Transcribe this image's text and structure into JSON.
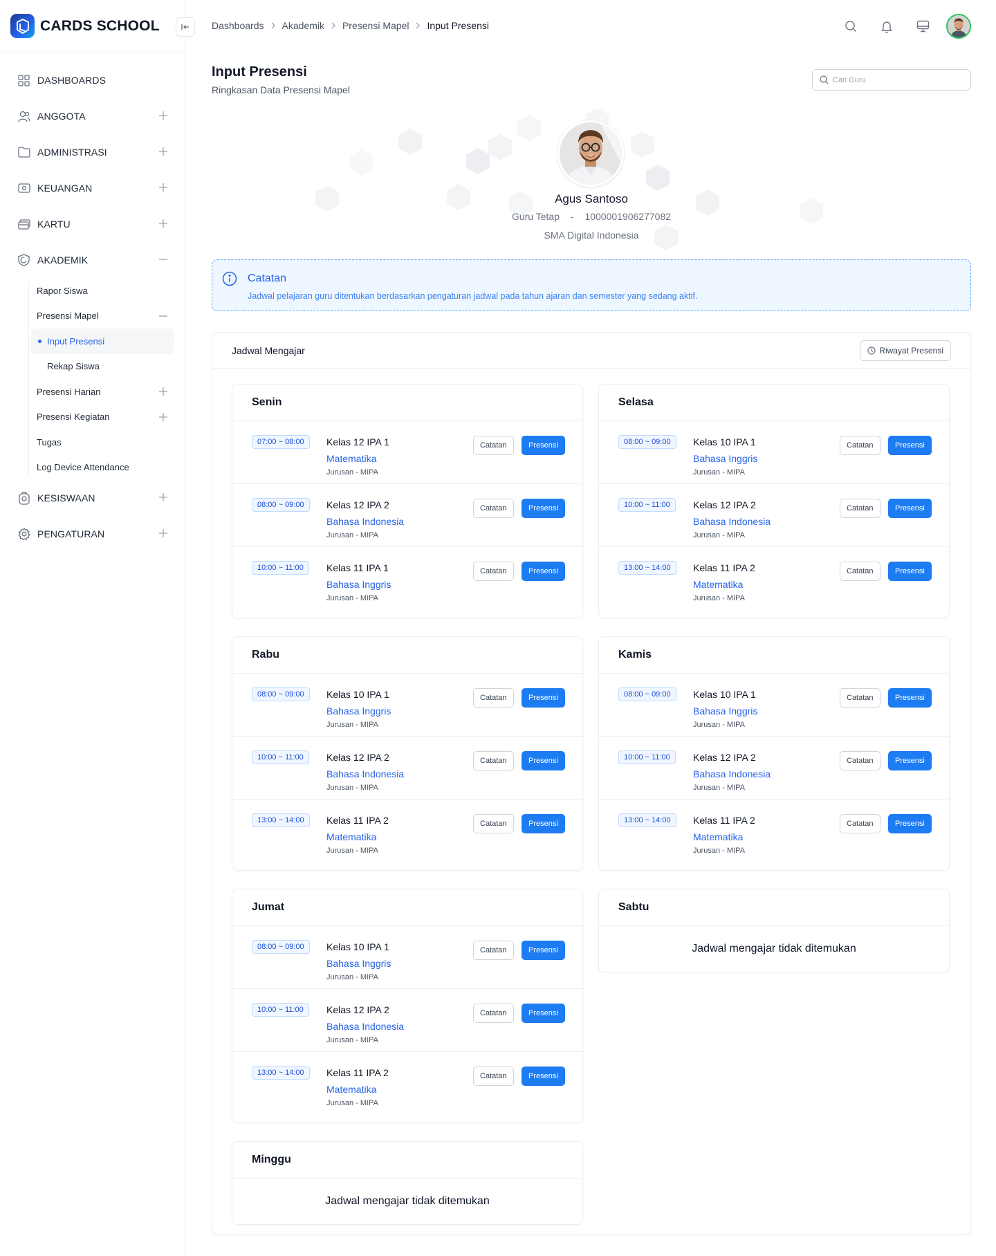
{
  "brand": {
    "name": "CARDS SCHOOL"
  },
  "sidebar": {
    "items": [
      {
        "label": "DASHBOARDS"
      },
      {
        "label": "ANGGOTA"
      },
      {
        "label": "ADMINISTRASI"
      },
      {
        "label": "KEUANGAN"
      },
      {
        "label": "KARTU"
      },
      {
        "label": "AKADEMIK"
      },
      {
        "label": "KESISWAAN"
      },
      {
        "label": "PENGATURAN"
      }
    ],
    "akademik": {
      "rapor": "Rapor Siswa",
      "presensi_mapel": "Presensi Mapel",
      "input_presensi": "Input Presensi",
      "rekap_siswa": "Rekap Siswa",
      "presensi_harian": "Presensi Harian",
      "presensi_kegiatan": "Presensi Kegiatan",
      "tugas": "Tugas",
      "log_device": "Log Device Attendance"
    }
  },
  "breadcrumb": [
    "Dashboards",
    "Akademik",
    "Presensi Mapel",
    "Input Presensi"
  ],
  "page": {
    "title": "Input Presensi",
    "subtitle": "Ringkasan Data Presensi Mapel",
    "search_placeholder": "Cari Guru"
  },
  "profile": {
    "name": "Agus Santoso",
    "status": "Guru Tetap",
    "dash": "-",
    "nip": "1000001906277082",
    "school": "SMA Digital Indonesia"
  },
  "note": {
    "title": "Catatan",
    "text": "Jadwal pelajaran guru ditentukan berdasarkan pengaturan jadwal pada tahun ajaran dan semester yang sedang aktif."
  },
  "schedule": {
    "title": "Jadwal Mengajar",
    "history_label": "Riwayat Presensi",
    "note_btn": "Catatan",
    "presensi_btn": "Presensi",
    "empty_text": "Jadwal mengajar tidak ditemukan",
    "days": [
      {
        "name": "Senin",
        "slots": [
          {
            "time": "07:00 ~ 08:00",
            "class": "Kelas 12 IPA 1",
            "subject": "Matematika",
            "major": "Jurusan - MIPA"
          },
          {
            "time": "08:00 ~ 09:00",
            "class": "Kelas 12 IPA 2",
            "subject": "Bahasa Indonesia",
            "major": "Jurusan - MIPA"
          },
          {
            "time": "10:00 ~ 11:00",
            "class": "Kelas 11 IPA 1",
            "subject": "Bahasa Inggris",
            "major": "Jurusan - MIPA"
          }
        ]
      },
      {
        "name": "Selasa",
        "slots": [
          {
            "time": "08:00 ~ 09:00",
            "class": "Kelas 10 IPA 1",
            "subject": "Bahasa Inggris",
            "major": "Jurusan - MIPA"
          },
          {
            "time": "10:00 ~ 11:00",
            "class": "Kelas 12 IPA 2",
            "subject": "Bahasa Indonesia",
            "major": "Jurusan - MIPA"
          },
          {
            "time": "13:00 ~ 14:00",
            "class": "Kelas 11 IPA 2",
            "subject": "Matematika",
            "major": "Jurusan - MIPA"
          }
        ]
      },
      {
        "name": "Rabu",
        "slots": [
          {
            "time": "08:00 ~ 09:00",
            "class": "Kelas 10 IPA 1",
            "subject": "Bahasa Inggris",
            "major": "Jurusan - MIPA"
          },
          {
            "time": "10:00 ~ 11:00",
            "class": "Kelas 12 IPA 2",
            "subject": "Bahasa Indonesia",
            "major": "Jurusan - MIPA"
          },
          {
            "time": "13:00 ~ 14:00",
            "class": "Kelas 11 IPA 2",
            "subject": "Matematika",
            "major": "Jurusan - MIPA"
          }
        ]
      },
      {
        "name": "Kamis",
        "slots": [
          {
            "time": "08:00 ~ 09:00",
            "class": "Kelas 10 IPA 1",
            "subject": "Bahasa Inggris",
            "major": "Jurusan - MIPA"
          },
          {
            "time": "10:00 ~ 11:00",
            "class": "Kelas 12 IPA 2",
            "subject": "Bahasa Indonesia",
            "major": "Jurusan - MIPA"
          },
          {
            "time": "13:00 ~ 14:00",
            "class": "Kelas 11 IPA 2",
            "subject": "Matematika",
            "major": "Jurusan - MIPA"
          }
        ]
      },
      {
        "name": "Jumat",
        "slots": [
          {
            "time": "08:00 ~ 09:00",
            "class": "Kelas 10 IPA 1",
            "subject": "Bahasa Inggris",
            "major": "Jurusan - MIPA"
          },
          {
            "time": "10:00 ~ 11:00",
            "class": "Kelas 12 IPA 2",
            "subject": "Bahasa Indonesia",
            "major": "Jurusan - MIPA"
          },
          {
            "time": "13:00 ~ 14:00",
            "class": "Kelas 11 IPA 2",
            "subject": "Matematika",
            "major": "Jurusan - MIPA"
          }
        ]
      },
      {
        "name": "Sabtu",
        "slots": []
      },
      {
        "name": "Minggu",
        "slots": []
      }
    ]
  },
  "colors": {
    "accent": "#1d7cf2",
    "link": "#2563eb",
    "note_bg": "#eef6ff",
    "note_border": "#60a5fa",
    "avatar_ring": "#22c55e"
  }
}
